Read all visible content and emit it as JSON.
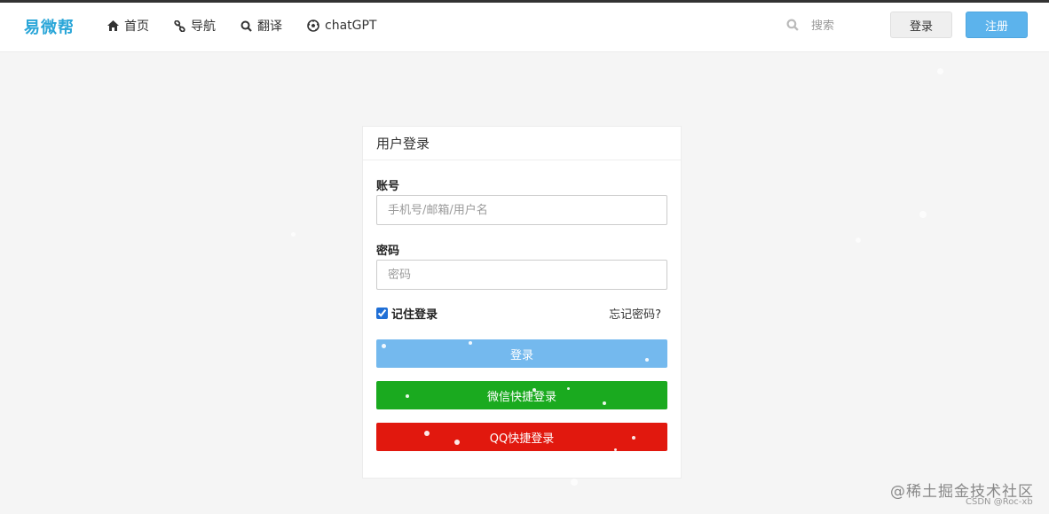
{
  "brand": "易微帮",
  "nav": [
    {
      "label": "首页",
      "icon": "home-icon"
    },
    {
      "label": "导航",
      "icon": "link-icon"
    },
    {
      "label": "翻译",
      "icon": "search-icon"
    },
    {
      "label": "chatGPT",
      "icon": "soccer-ball-icon"
    }
  ],
  "search": {
    "placeholder": "搜索",
    "icon": "search-icon"
  },
  "top_buttons": {
    "login": "登录",
    "register": "注册"
  },
  "login_card": {
    "title": "用户登录",
    "account_label": "账号",
    "account_placeholder": "手机号/邮箱/用户名",
    "password_label": "密码",
    "password_placeholder": "密码",
    "remember_label": "记住登录",
    "remember_checked": true,
    "forgot_link": "忘记密码?",
    "login_button": "登录",
    "wechat_button": "微信快捷登录",
    "qq_button": "QQ快捷登录"
  },
  "watermark": {
    "text": "@稀土掘金技术社区",
    "sub": "CSDN @Roc-xb"
  },
  "colors": {
    "brand": "#2aa6d8",
    "login_button": "#74b9ee",
    "wechat_button": "#1aaa1f",
    "qq_button": "#e1180e",
    "register_button": "#5cb3ec"
  }
}
